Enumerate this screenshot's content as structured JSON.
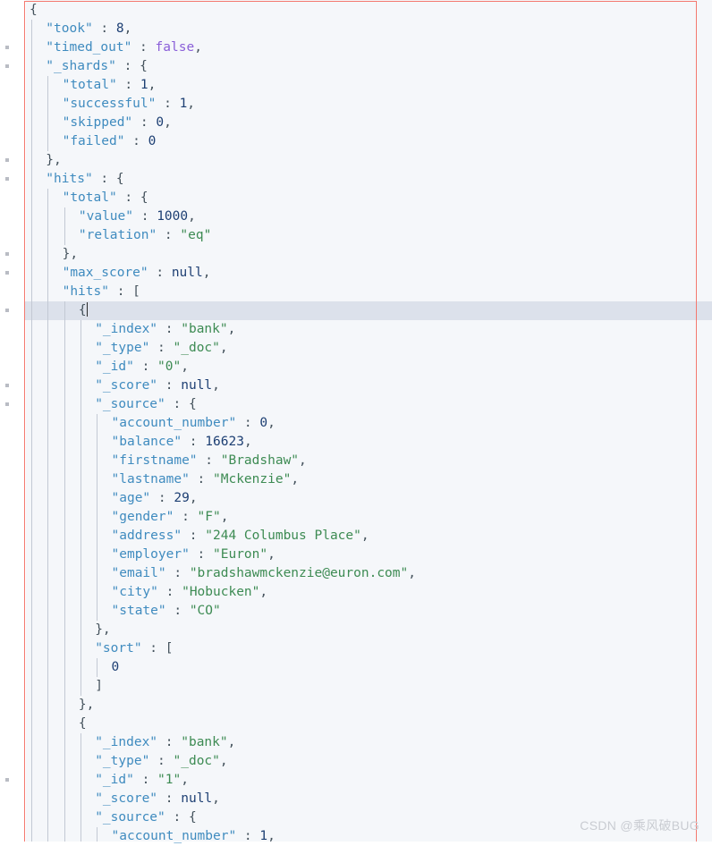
{
  "editor": {
    "language": "json",
    "colors": {
      "background": "#f5f7fa",
      "key": "#3f8bbf",
      "string": "#3d8b53",
      "number": "#1d3f73",
      "boolean": "#8a5fd8",
      "null": "#1d3f73",
      "punctuation": "#44525c",
      "selection_border": "#f4786f",
      "current_line": "#d7dde8"
    },
    "current_line_index": 16,
    "caret_line_text": "{"
  },
  "watermark": {
    "text": "CSDN @乘风破BUG"
  },
  "document": {
    "title": "Elasticsearch search response",
    "lines": [
      {
        "indent": 0,
        "tokens": [
          {
            "t": "{",
            "c": "p"
          }
        ]
      },
      {
        "indent": 1,
        "tokens": [
          {
            "t": "\"took\"",
            "c": "k"
          },
          {
            "t": " : ",
            "c": "p"
          },
          {
            "t": "8",
            "c": "num"
          },
          {
            "t": ",",
            "c": "p"
          }
        ]
      },
      {
        "indent": 1,
        "tokens": [
          {
            "t": "\"timed_out\"",
            "c": "k"
          },
          {
            "t": " : ",
            "c": "p"
          },
          {
            "t": "false",
            "c": "bool"
          },
          {
            "t": ",",
            "c": "p"
          }
        ]
      },
      {
        "indent": 1,
        "tokens": [
          {
            "t": "\"_shards\"",
            "c": "k"
          },
          {
            "t": " : {",
            "c": "p"
          }
        ]
      },
      {
        "indent": 2,
        "tokens": [
          {
            "t": "\"total\"",
            "c": "k"
          },
          {
            "t": " : ",
            "c": "p"
          },
          {
            "t": "1",
            "c": "num"
          },
          {
            "t": ",",
            "c": "p"
          }
        ]
      },
      {
        "indent": 2,
        "tokens": [
          {
            "t": "\"successful\"",
            "c": "k"
          },
          {
            "t": " : ",
            "c": "p"
          },
          {
            "t": "1",
            "c": "num"
          },
          {
            "t": ",",
            "c": "p"
          }
        ]
      },
      {
        "indent": 2,
        "tokens": [
          {
            "t": "\"skipped\"",
            "c": "k"
          },
          {
            "t": " : ",
            "c": "p"
          },
          {
            "t": "0",
            "c": "num"
          },
          {
            "t": ",",
            "c": "p"
          }
        ]
      },
      {
        "indent": 2,
        "tokens": [
          {
            "t": "\"failed\"",
            "c": "k"
          },
          {
            "t": " : ",
            "c": "p"
          },
          {
            "t": "0",
            "c": "num"
          }
        ]
      },
      {
        "indent": 1,
        "tokens": [
          {
            "t": "},",
            "c": "p"
          }
        ]
      },
      {
        "indent": 1,
        "tokens": [
          {
            "t": "\"hits\"",
            "c": "k"
          },
          {
            "t": " : {",
            "c": "p"
          }
        ]
      },
      {
        "indent": 2,
        "tokens": [
          {
            "t": "\"total\"",
            "c": "k"
          },
          {
            "t": " : {",
            "c": "p"
          }
        ]
      },
      {
        "indent": 3,
        "tokens": [
          {
            "t": "\"value\"",
            "c": "k"
          },
          {
            "t": " : ",
            "c": "p"
          },
          {
            "t": "1000",
            "c": "num"
          },
          {
            "t": ",",
            "c": "p"
          }
        ]
      },
      {
        "indent": 3,
        "tokens": [
          {
            "t": "\"relation\"",
            "c": "k"
          },
          {
            "t": " : ",
            "c": "p"
          },
          {
            "t": "\"eq\"",
            "c": "str"
          }
        ]
      },
      {
        "indent": 2,
        "tokens": [
          {
            "t": "},",
            "c": "p"
          }
        ]
      },
      {
        "indent": 2,
        "tokens": [
          {
            "t": "\"max_score\"",
            "c": "k"
          },
          {
            "t": " : ",
            "c": "p"
          },
          {
            "t": "null",
            "c": "nul"
          },
          {
            "t": ",",
            "c": "p"
          }
        ]
      },
      {
        "indent": 2,
        "tokens": [
          {
            "t": "\"hits\"",
            "c": "k"
          },
          {
            "t": " : [",
            "c": "p"
          }
        ]
      },
      {
        "indent": 3,
        "caret": true,
        "tokens": [
          {
            "t": "{",
            "c": "p"
          }
        ]
      },
      {
        "indent": 4,
        "tokens": [
          {
            "t": "\"_index\"",
            "c": "k"
          },
          {
            "t": " : ",
            "c": "p"
          },
          {
            "t": "\"bank\"",
            "c": "str"
          },
          {
            "t": ",",
            "c": "p"
          }
        ]
      },
      {
        "indent": 4,
        "tokens": [
          {
            "t": "\"_type\"",
            "c": "k"
          },
          {
            "t": " : ",
            "c": "p"
          },
          {
            "t": "\"_doc\"",
            "c": "str"
          },
          {
            "t": ",",
            "c": "p"
          }
        ]
      },
      {
        "indent": 4,
        "tokens": [
          {
            "t": "\"_id\"",
            "c": "k"
          },
          {
            "t": " : ",
            "c": "p"
          },
          {
            "t": "\"0\"",
            "c": "str"
          },
          {
            "t": ",",
            "c": "p"
          }
        ]
      },
      {
        "indent": 4,
        "tokens": [
          {
            "t": "\"_score\"",
            "c": "k"
          },
          {
            "t": " : ",
            "c": "p"
          },
          {
            "t": "null",
            "c": "nul"
          },
          {
            "t": ",",
            "c": "p"
          }
        ]
      },
      {
        "indent": 4,
        "tokens": [
          {
            "t": "\"_source\"",
            "c": "k"
          },
          {
            "t": " : {",
            "c": "p"
          }
        ]
      },
      {
        "indent": 5,
        "tokens": [
          {
            "t": "\"account_number\"",
            "c": "k"
          },
          {
            "t": " : ",
            "c": "p"
          },
          {
            "t": "0",
            "c": "num"
          },
          {
            "t": ",",
            "c": "p"
          }
        ]
      },
      {
        "indent": 5,
        "tokens": [
          {
            "t": "\"balance\"",
            "c": "k"
          },
          {
            "t": " : ",
            "c": "p"
          },
          {
            "t": "16623",
            "c": "num"
          },
          {
            "t": ",",
            "c": "p"
          }
        ]
      },
      {
        "indent": 5,
        "tokens": [
          {
            "t": "\"firstname\"",
            "c": "k"
          },
          {
            "t": " : ",
            "c": "p"
          },
          {
            "t": "\"Bradshaw\"",
            "c": "str"
          },
          {
            "t": ",",
            "c": "p"
          }
        ]
      },
      {
        "indent": 5,
        "tokens": [
          {
            "t": "\"lastname\"",
            "c": "k"
          },
          {
            "t": " : ",
            "c": "p"
          },
          {
            "t": "\"Mckenzie\"",
            "c": "str"
          },
          {
            "t": ",",
            "c": "p"
          }
        ]
      },
      {
        "indent": 5,
        "tokens": [
          {
            "t": "\"age\"",
            "c": "k"
          },
          {
            "t": " : ",
            "c": "p"
          },
          {
            "t": "29",
            "c": "num"
          },
          {
            "t": ",",
            "c": "p"
          }
        ]
      },
      {
        "indent": 5,
        "tokens": [
          {
            "t": "\"gender\"",
            "c": "k"
          },
          {
            "t": " : ",
            "c": "p"
          },
          {
            "t": "\"F\"",
            "c": "str"
          },
          {
            "t": ",",
            "c": "p"
          }
        ]
      },
      {
        "indent": 5,
        "tokens": [
          {
            "t": "\"address\"",
            "c": "k"
          },
          {
            "t": " : ",
            "c": "p"
          },
          {
            "t": "\"244 Columbus Place\"",
            "c": "str"
          },
          {
            "t": ",",
            "c": "p"
          }
        ]
      },
      {
        "indent": 5,
        "tokens": [
          {
            "t": "\"employer\"",
            "c": "k"
          },
          {
            "t": " : ",
            "c": "p"
          },
          {
            "t": "\"Euron\"",
            "c": "str"
          },
          {
            "t": ",",
            "c": "p"
          }
        ]
      },
      {
        "indent": 5,
        "tokens": [
          {
            "t": "\"email\"",
            "c": "k"
          },
          {
            "t": " : ",
            "c": "p"
          },
          {
            "t": "\"bradshawmckenzie@euron.com\"",
            "c": "str"
          },
          {
            "t": ",",
            "c": "p"
          }
        ]
      },
      {
        "indent": 5,
        "tokens": [
          {
            "t": "\"city\"",
            "c": "k"
          },
          {
            "t": " : ",
            "c": "p"
          },
          {
            "t": "\"Hobucken\"",
            "c": "str"
          },
          {
            "t": ",",
            "c": "p"
          }
        ]
      },
      {
        "indent": 5,
        "tokens": [
          {
            "t": "\"state\"",
            "c": "k"
          },
          {
            "t": " : ",
            "c": "p"
          },
          {
            "t": "\"CO\"",
            "c": "str"
          }
        ]
      },
      {
        "indent": 4,
        "tokens": [
          {
            "t": "},",
            "c": "p"
          }
        ]
      },
      {
        "indent": 4,
        "tokens": [
          {
            "t": "\"sort\"",
            "c": "k"
          },
          {
            "t": " : [",
            "c": "p"
          }
        ]
      },
      {
        "indent": 5,
        "tokens": [
          {
            "t": "0",
            "c": "num"
          }
        ]
      },
      {
        "indent": 4,
        "tokens": [
          {
            "t": "]",
            "c": "p"
          }
        ]
      },
      {
        "indent": 3,
        "tokens": [
          {
            "t": "},",
            "c": "p"
          }
        ]
      },
      {
        "indent": 3,
        "tokens": [
          {
            "t": "{",
            "c": "p"
          }
        ]
      },
      {
        "indent": 4,
        "tokens": [
          {
            "t": "\"_index\"",
            "c": "k"
          },
          {
            "t": " : ",
            "c": "p"
          },
          {
            "t": "\"bank\"",
            "c": "str"
          },
          {
            "t": ",",
            "c": "p"
          }
        ]
      },
      {
        "indent": 4,
        "tokens": [
          {
            "t": "\"_type\"",
            "c": "k"
          },
          {
            "t": " : ",
            "c": "p"
          },
          {
            "t": "\"_doc\"",
            "c": "str"
          },
          {
            "t": ",",
            "c": "p"
          }
        ]
      },
      {
        "indent": 4,
        "tokens": [
          {
            "t": "\"_id\"",
            "c": "k"
          },
          {
            "t": " : ",
            "c": "p"
          },
          {
            "t": "\"1\"",
            "c": "str"
          },
          {
            "t": ",",
            "c": "p"
          }
        ]
      },
      {
        "indent": 4,
        "tokens": [
          {
            "t": "\"_score\"",
            "c": "k"
          },
          {
            "t": " : ",
            "c": "p"
          },
          {
            "t": "null",
            "c": "nul"
          },
          {
            "t": ",",
            "c": "p"
          }
        ]
      },
      {
        "indent": 4,
        "tokens": [
          {
            "t": "\"_source\"",
            "c": "k"
          },
          {
            "t": " : {",
            "c": "p"
          }
        ]
      },
      {
        "indent": 5,
        "tokens": [
          {
            "t": "\"account_number\"",
            "c": "k"
          },
          {
            "t": " : ",
            "c": "p"
          },
          {
            "t": "1",
            "c": "num"
          },
          {
            "t": ",",
            "c": "p"
          }
        ]
      }
    ],
    "fold_marker_lines": [
      2,
      3,
      8,
      9,
      13,
      14,
      16,
      20,
      21,
      41
    ]
  }
}
